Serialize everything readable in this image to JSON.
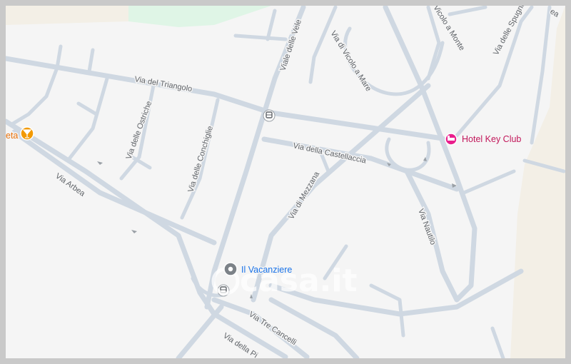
{
  "map": {
    "colors": {
      "background": "#f5f5f5",
      "road": "#cfd8e2",
      "park": "#dff5e6",
      "sand": "#f3efe6",
      "poi_pink": "#e91e8c",
      "poi_blue": "#1a73e8",
      "poi_orange": "#f29900"
    },
    "streets": {
      "triangolo": "Via del Triangolo",
      "vele": "Viale delle Vele",
      "vicolo_mare": "Via di Vicolo a Mare",
      "vicolo_monte": "Vicolo a Monte",
      "spugne": "Via delle Spugne",
      "ostriche": "Via delle Ostriche",
      "conchiglie": "Via delle Conchiglie",
      "castellaccia": "Via della Castellaccia",
      "arbea": "Via Arbea",
      "mezzana": "Via di Mezzana",
      "nautilo": "Via Nautilo",
      "tre_cancelli": "Via Tre Cancelli",
      "della_pi": "Via della Pi",
      "top_right_fragment": "ea"
    },
    "pois": {
      "hotel": {
        "name": "Hotel Key Club",
        "icon": "hotel-icon"
      },
      "vacanziere": {
        "name": "Il Vacanziere",
        "icon": "place-pin-icon"
      },
      "bar": {
        "name": "eta",
        "icon": "cocktail-icon"
      }
    },
    "watermark": "casa.it"
  }
}
